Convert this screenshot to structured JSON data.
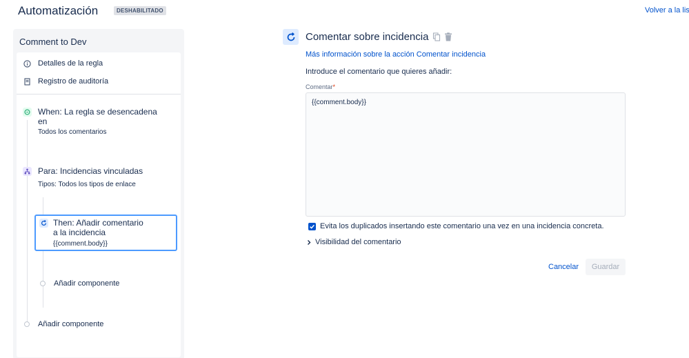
{
  "header": {
    "title": "Automatización",
    "status": "DESHABILITADO",
    "back_link": "Volver a la lista"
  },
  "sidebar": {
    "rule_name": "Comment to Dev",
    "links": [
      {
        "label": "Detalles de la regla",
        "icon": "info-icon"
      },
      {
        "label": "Registro de auditoría",
        "icon": "document-icon"
      }
    ],
    "steps": {
      "trigger": {
        "title_line1": "When: La regla se desencadena",
        "title_line2": "en",
        "subtitle": "Todos los comentarios",
        "icon": "comment-trigger-icon",
        "color": "#36b37e"
      },
      "branch": {
        "title": "Para: Incidencias vinculadas",
        "subtitle": "Tipos: Todos los tipos de enlace",
        "icon": "branch-icon",
        "color": "#6554c0"
      },
      "action": {
        "title_line1": "Then: Añadir comentario",
        "title_line2": "a la incidencia",
        "subtitle": "{{comment.body}}",
        "icon": "refresh-action-icon",
        "color": "#0052cc"
      }
    },
    "add_component_inner": "Añadir componente",
    "add_component_outer": "Añadir componente"
  },
  "main": {
    "action_title": "Comentar sobre incidencia",
    "info_link": "Más información sobre la acción Comentar incidencia",
    "intro": "Introduce el comentario que quieres añadir:",
    "field_label": "Comentar",
    "required_mark": "*",
    "comment_value": "{{comment.body}}",
    "checkbox_label": "Evita los duplicados insertando este comentario una vez en una incidencia concreta.",
    "checkbox_checked": true,
    "visibility_label": "Visibilidad del comentario",
    "cancel_label": "Cancelar",
    "save_label": "Guardar"
  }
}
